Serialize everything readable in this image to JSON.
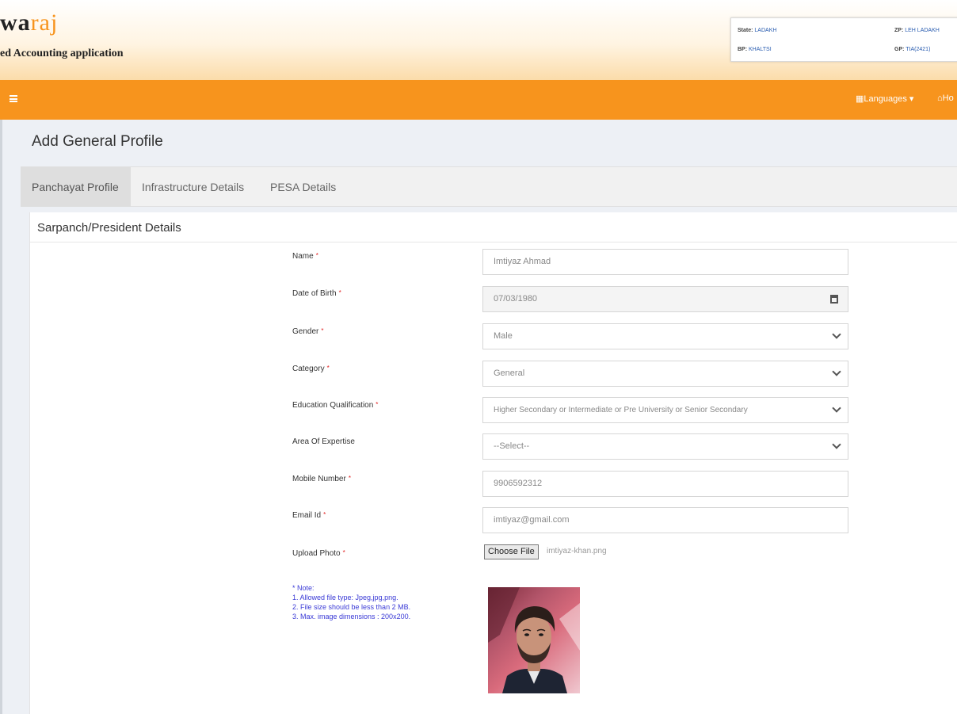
{
  "header": {
    "brand_prefix": "w",
    "brand_mid": "a",
    "brand_accent": "raj",
    "subtitle": "ed Accounting application",
    "info": {
      "state_key": "State:",
      "state_val": "LADAKH",
      "zp_key": "ZP:",
      "zp_val": "LEH LADAKH",
      "bp_key": "BP:",
      "bp_val": "KHALTSI",
      "gp_key": "GP:",
      "gp_val": "TIA(2421)"
    }
  },
  "navbar": {
    "languages_label": "Languages",
    "home_label": "Ho"
  },
  "page": {
    "title": "Add General Profile",
    "tabs": [
      {
        "label": "Panchayat Profile",
        "active": true
      },
      {
        "label": "Infrastructure Details",
        "active": false
      },
      {
        "label": "PESA Details",
        "active": false
      }
    ],
    "section_title": "Sarpanch/President Details"
  },
  "form": {
    "name": {
      "label": "Name",
      "value": "Imtiyaz Ahmad"
    },
    "dob": {
      "label": "Date of Birth",
      "value": "07/03/1980"
    },
    "gender": {
      "label": "Gender",
      "value": "Male"
    },
    "category": {
      "label": "Category",
      "value": "General"
    },
    "education": {
      "label": "Education Qualification",
      "value": "Higher Secondary or Intermediate or Pre University or Senior Secondary"
    },
    "expertise": {
      "label": "Area Of Expertise",
      "value": "--Select--"
    },
    "mobile": {
      "label": "Mobile Number",
      "value": "9906592312"
    },
    "email": {
      "label": "Email Id",
      "value": "imtiyaz@gmail.com"
    },
    "photo": {
      "label": "Upload Photo",
      "button": "Choose File",
      "file_name": "imtiyaz-khan.png"
    },
    "required_mark": "*"
  },
  "note": {
    "title": "* Note:",
    "line1": "1. Allowed file type: Jpeg,jpg,png.",
    "line2": "2. File size should be less than 2 MB.",
    "line3": "3. Max. image dimensions : 200x200."
  },
  "colors": {
    "accent": "#f7941d",
    "note": "#3a3ad6",
    "required": "#e02020"
  }
}
